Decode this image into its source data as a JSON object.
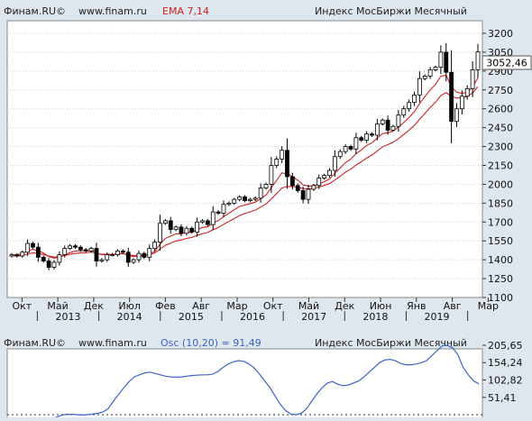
{
  "main_header": {
    "source": "Финам.RU©",
    "url": "www.finam.ru",
    "indicator": "EMA 7,14",
    "title": "Индекс МосБиржи Месячный"
  },
  "osc_header": {
    "source": "Финам.RU©",
    "url": "www.finam.ru",
    "indicator": "Osc (10,20) = 91,49",
    "title": "Индекс МосБиржи Месячный"
  },
  "last_price_label": "3052,46",
  "colors": {
    "background": "#dfe7ee",
    "plot_area": "#ffffff",
    "ema_line": "#cc2222",
    "osc_line": "#3b63c7",
    "indicator_text": "#cc2222",
    "osc_indicator_text": "#3b63c7"
  },
  "chart_data": [
    {
      "type": "candlestick",
      "y_axis_ticks": [
        "3200",
        "3050",
        "2900",
        "2750",
        "2600",
        "2450",
        "2300",
        "2150",
        "2000",
        "1850",
        "1700",
        "1550",
        "1400",
        "1250",
        "1100"
      ],
      "ylim": [
        1100,
        3300
      ],
      "x_month_labels": [
        "Окт",
        "Май",
        "Дек",
        "Июл",
        "Фев",
        "Авг",
        "Мар",
        "Окт",
        "Май",
        "Дек",
        "Июн",
        "Янв",
        "Авг",
        "Мар"
      ],
      "x_year_labels": [
        "2013",
        "2014",
        "2015",
        "2016",
        "2017",
        "2018",
        "2019"
      ],
      "x_start": "2012-08",
      "x_end": "2020-03",
      "close_series": [
        1440,
        1430,
        1460,
        1530,
        1500,
        1420,
        1390,
        1340,
        1380,
        1440,
        1490,
        1510,
        1500,
        1480,
        1470,
        1490,
        1390,
        1400,
        1440,
        1440,
        1470,
        1460,
        1380,
        1400,
        1450,
        1420,
        1490,
        1540,
        1690,
        1710,
        1640,
        1660,
        1610,
        1650,
        1620,
        1700,
        1710,
        1680,
        1780,
        1770,
        1840,
        1850,
        1880,
        1900,
        1870,
        1880,
        1890,
        1970,
        2000,
        2150,
        2200,
        2270,
        2060,
        1990,
        1950,
        1880,
        1960,
        1990,
        2050,
        2070,
        2110,
        2220,
        2260,
        2300,
        2280,
        2370,
        2350,
        2400,
        2390,
        2480,
        2510,
        2430,
        2460,
        2550,
        2600,
        2650,
        2710,
        2840,
        2860,
        2910,
        2930,
        3050,
        2890,
        2500,
        2600,
        2700,
        2760,
        2910,
        3052
      ],
      "ema_fast": [
        1436,
        1440,
        1450,
        1470,
        1483,
        1471,
        1453,
        1425,
        1413,
        1421,
        1439,
        1457,
        1468,
        1471,
        1471,
        1476,
        1454,
        1440,
        1440,
        1440,
        1448,
        1451,
        1433,
        1425,
        1431,
        1428,
        1443,
        1467,
        1523,
        1570,
        1588,
        1606,
        1607,
        1618,
        1618,
        1639,
        1657,
        1662,
        1692,
        1711,
        1743,
        1770,
        1798,
        1824,
        1836,
        1847,
        1858,
        1886,
        1915,
        1973,
        2030,
        2090,
        2083,
        2060,
        2032,
        1994,
        1986,
        1987,
        2003,
        2020,
        2043,
        2087,
        2130,
        2172,
        2200,
        2244,
        2273,
        2309,
        2330,
        2368,
        2403,
        2410,
        2423,
        2455,
        2491,
        2531,
        2576,
        2642,
        2697,
        2750,
        2795,
        2859,
        2867,
        2775,
        2731,
        2723,
        2732,
        2777,
        2846
      ],
      "ema_slow": [
        1430,
        1430,
        1434,
        1447,
        1454,
        1450,
        1442,
        1429,
        1422,
        1424,
        1433,
        1443,
        1450,
        1454,
        1456,
        1461,
        1451,
        1444,
        1443,
        1443,
        1446,
        1448,
        1439,
        1434,
        1436,
        1434,
        1441,
        1454,
        1485,
        1515,
        1532,
        1549,
        1557,
        1570,
        1577,
        1593,
        1608,
        1617,
        1639,
        1657,
        1682,
        1704,
        1728,
        1751,
        1767,
        1781,
        1795,
        1819,
        1843,
        1884,
        1926,
        1971,
        1982,
        1983,
        1978,
        1965,
        1964,
        1967,
        1978,
        1991,
        2006,
        2034,
        2064,
        2096,
        2120,
        2153,
        2179,
        2208,
        2232,
        2265,
        2298,
        2315,
        2334,
        2363,
        2396,
        2430,
        2467,
        2518,
        2564,
        2610,
        2653,
        2705,
        2729,
        2699,
        2686,
        2688,
        2698,
        2726,
        2776
      ]
    },
    {
      "type": "line",
      "name": "Osc (10,20)",
      "y_axis_ticks": [
        "205,65",
        "154,24",
        "102,82",
        "51,41"
      ],
      "ylim": [
        0,
        205.65
      ],
      "values": [
        -40,
        -40,
        -38,
        -34,
        -30,
        -28,
        -25,
        -20,
        -14,
        -8,
        -2,
        1,
        1,
        0,
        -1,
        0,
        2,
        4,
        8,
        18,
        40,
        60,
        80,
        98,
        112,
        118,
        124,
        126,
        122,
        118,
        114,
        112,
        111,
        112,
        114,
        116,
        117,
        118,
        118,
        120,
        128,
        140,
        150,
        157,
        160,
        158,
        150,
        138,
        120,
        100,
        80,
        55,
        30,
        12,
        2,
        0,
        4,
        18,
        40,
        62,
        80,
        94,
        98,
        90,
        86,
        88,
        94,
        100,
        112,
        126,
        140,
        154,
        162,
        164,
        160,
        152,
        148,
        148,
        150,
        154,
        160,
        175,
        190,
        204,
        205,
        198,
        178,
        140,
        118,
        100,
        91.49
      ]
    }
  ]
}
